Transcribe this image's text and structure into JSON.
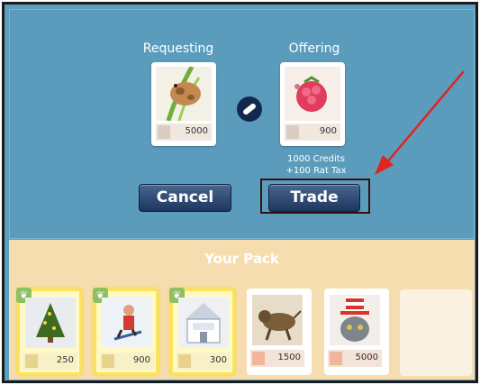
{
  "trade": {
    "requesting_label": "Requesting",
    "offering_label": "Offering",
    "requesting_value": "5000",
    "offering_value": "900",
    "credits_line": "1000 Credits",
    "tax_line": "+100 Rat Tax",
    "cancel_label": "Cancel",
    "trade_label": "Trade"
  },
  "pack": {
    "title": "Your Pack",
    "cards": [
      {
        "value": "250",
        "art": "christmas-tree",
        "rarity": "gold",
        "badge": "leaf-icon"
      },
      {
        "value": "900",
        "art": "skier",
        "rarity": "gold",
        "badge": "leaf-icon"
      },
      {
        "value": "300",
        "art": "barn-sign",
        "rarity": "gold",
        "badge": "leaf-icon"
      },
      {
        "value": "1500",
        "art": "creature",
        "rarity": "plain",
        "badge": ""
      },
      {
        "value": "5000",
        "art": "cat-in-hat",
        "rarity": "plain",
        "badge": ""
      }
    ]
  },
  "annotation": {
    "arrow_color": "#e1241d",
    "highlight_color": "#3a0f12"
  }
}
